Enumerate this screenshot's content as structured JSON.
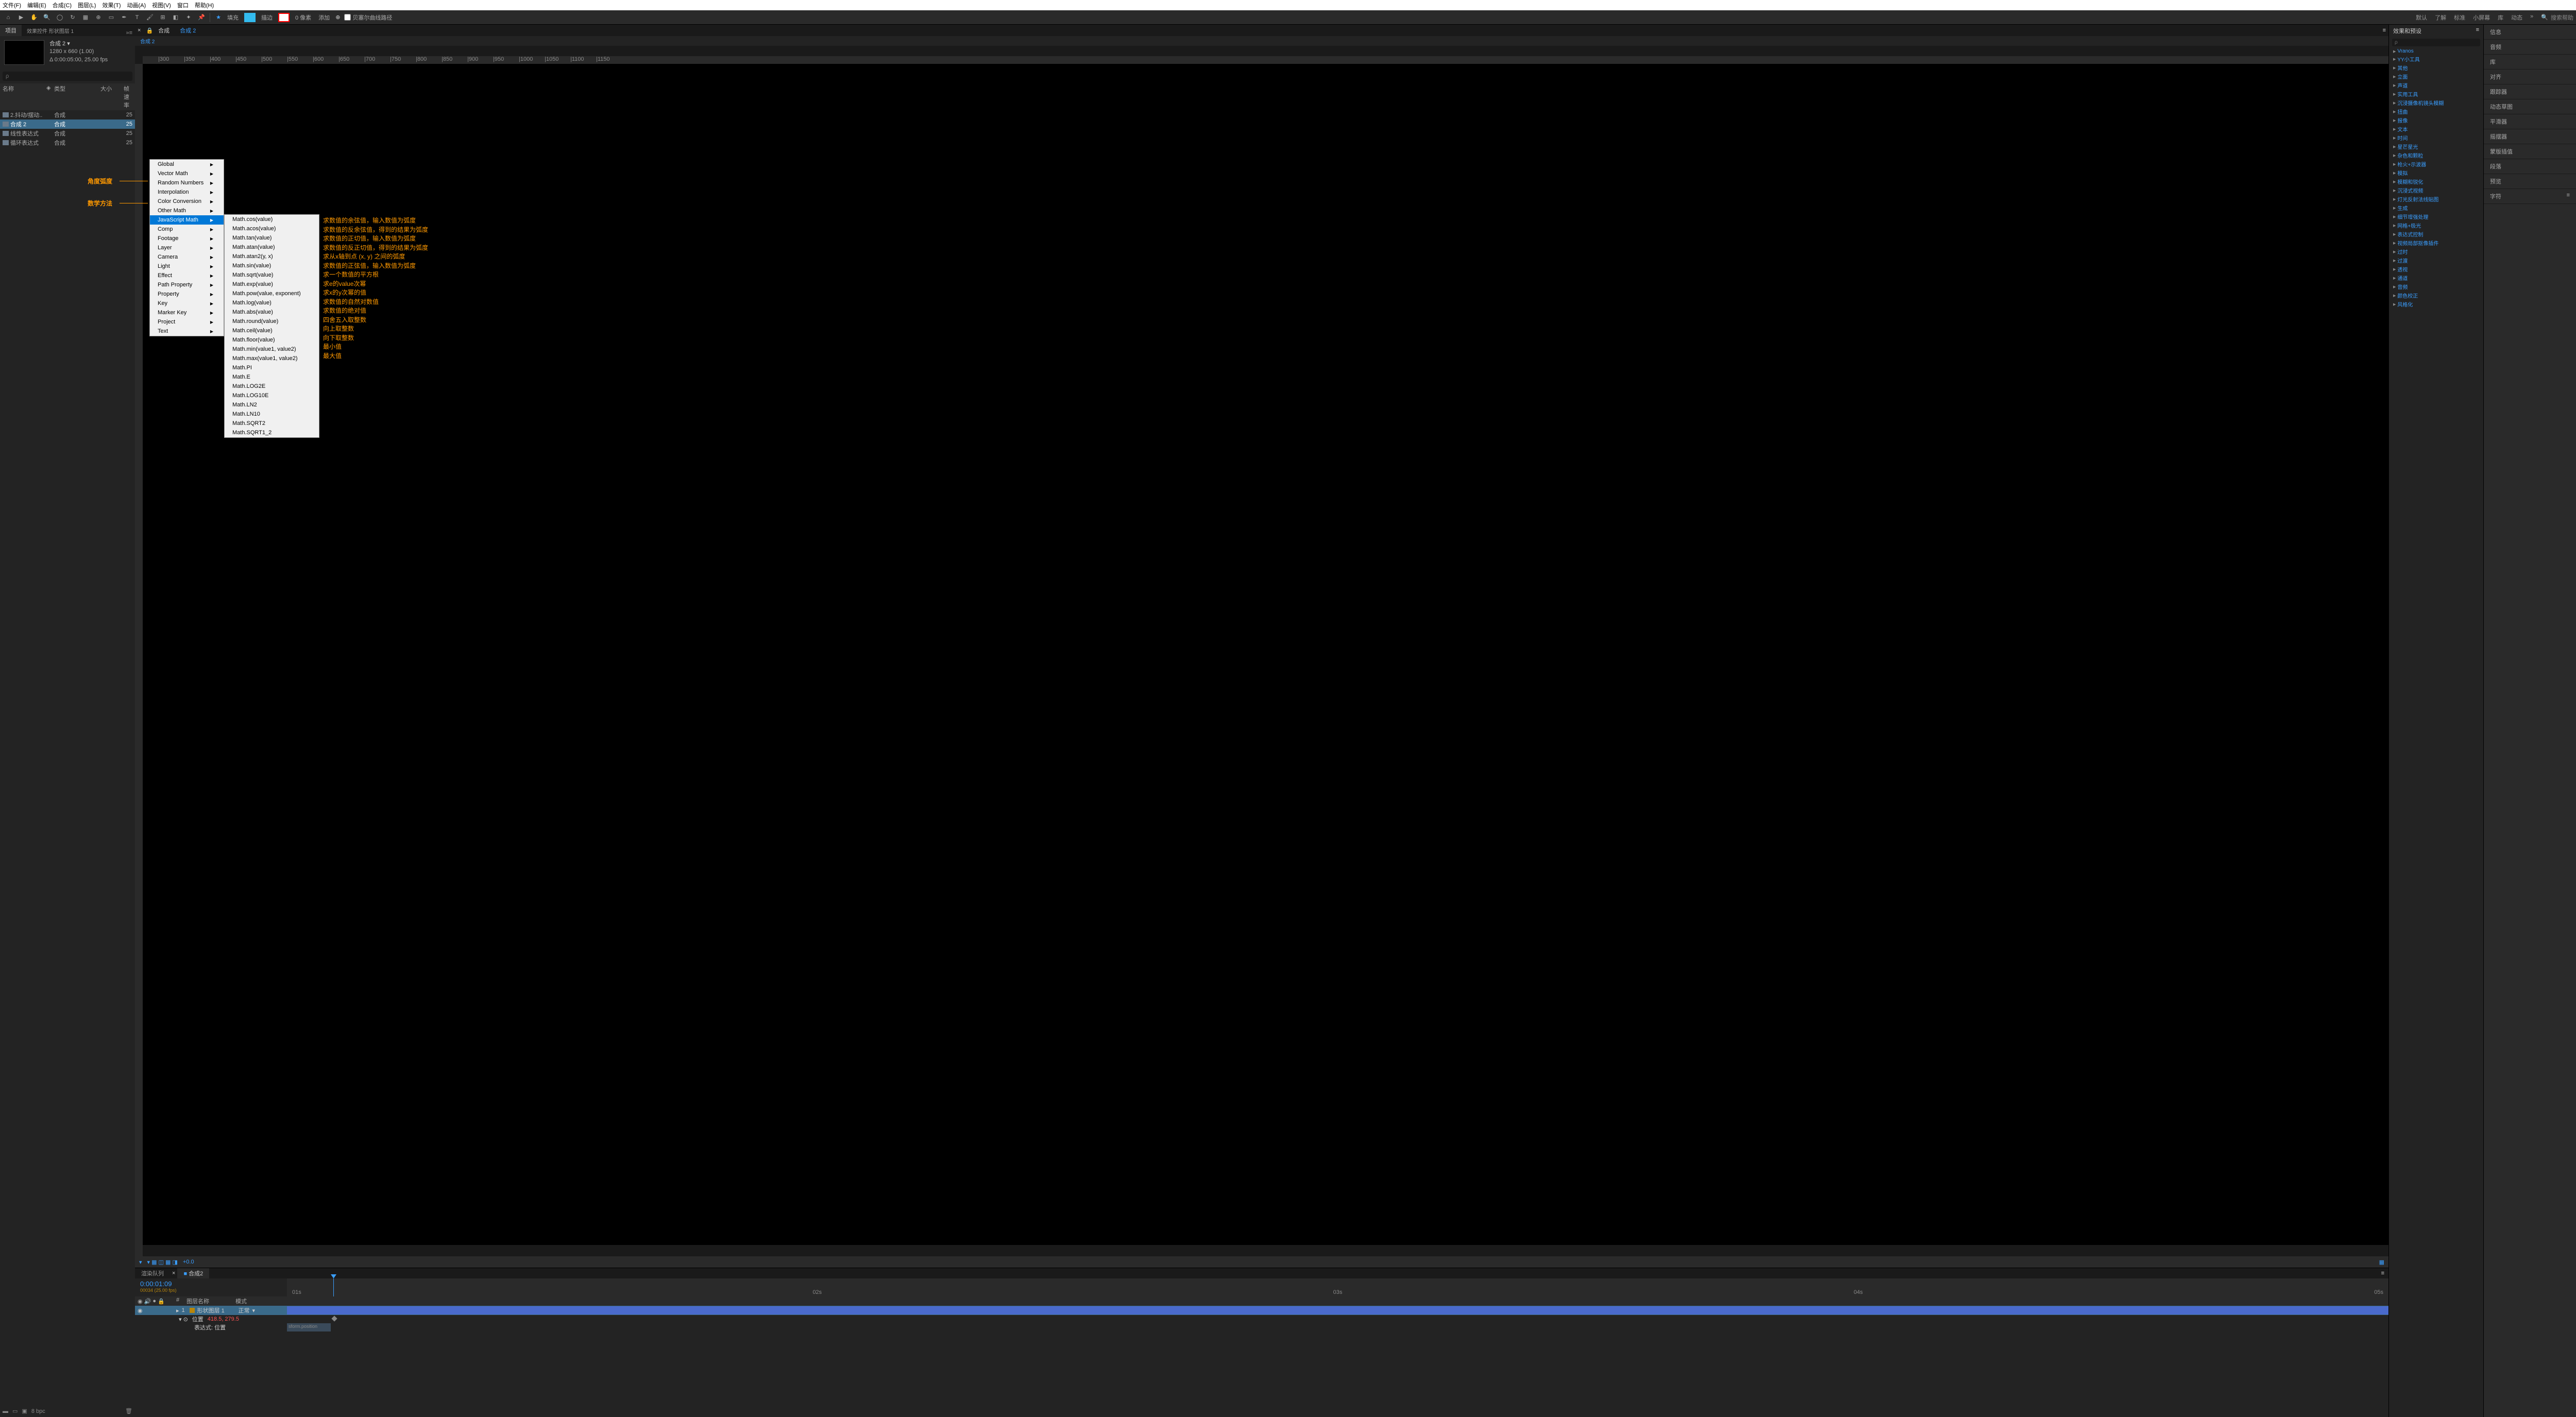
{
  "menubar": {
    "file": "文件(F)",
    "edit": "编辑(E)",
    "composition": "合成(C)",
    "layer": "图层(L)",
    "effect": "效果(T)",
    "animation": "动画(A)",
    "view": "视图(V)",
    "window": "窗口",
    "help": "帮助(H)"
  },
  "toolbar": {
    "fill_label": "填充",
    "fill_color": "#33bbee",
    "stroke_label": "描边",
    "stroke_px": "0 像素",
    "add_label": "添加",
    "bezier_label": "贝塞尔曲线路径"
  },
  "workspaces": {
    "default": "默认",
    "learn": "了解",
    "standard": "标准",
    "small_screen": "小屏幕",
    "library": "库",
    "animation": "动态",
    "search_placeholder": "搜索帮助"
  },
  "project": {
    "tab_label": "项目",
    "effect_controls_tab": "效果控件 形状图层 1",
    "comp_name": "合成 2",
    "comp_dims": "1280 x 660 (1.00)",
    "comp_dur": "Δ 0:00:05:00, 25.00 fps",
    "search_placeholder": "ρ",
    "cols": {
      "name": "名称",
      "tag": "",
      "type": "类型",
      "size": "大小",
      "fr": "帧速率"
    },
    "rows": [
      {
        "name": "2.抖动/摆动..",
        "type": "合成",
        "fr": "25",
        "sel": false
      },
      {
        "name": "合成 2",
        "type": "合成",
        "fr": "25",
        "sel": true
      },
      {
        "name": "线性表达式",
        "type": "合成",
        "fr": "25",
        "sel": false
      },
      {
        "name": "循环表达式",
        "type": "合成",
        "fr": "25",
        "sel": false
      }
    ],
    "footer_bpc": "8 bpc"
  },
  "viewer": {
    "tab1": "合成",
    "tab2": "合成 2",
    "breadcrumb": "合成 2",
    "footer_zoom": "+0.0"
  },
  "context_menu": {
    "items": [
      "Global",
      "Vector Math",
      "Random Numbers",
      "Interpolation",
      "Color Conversion",
      "Other Math",
      "JavaScript Math",
      "Comp",
      "Footage",
      "Layer",
      "Camera",
      "Light",
      "Effect",
      "Path Property",
      "Property",
      "Key",
      "Marker Key",
      "Project",
      "Text"
    ],
    "highlighted_index": 6
  },
  "submenu": {
    "items": [
      "Math.cos(value)",
      "Math.acos(value)",
      "Math.tan(value)",
      "Math.atan(value)",
      "Math.atan2(y, x)",
      "Math.sin(value)",
      "Math.sqrt(value)",
      "Math.exp(value)",
      "Math.pow(value, exponent)",
      "Math.log(value)",
      "Math.abs(value)",
      "Math.round(value)",
      "Math.ceil(value)",
      "Math.floor(value)",
      "Math.min(value1, value2)",
      "Math.max(value1, value2)",
      "Math.PI",
      "Math.E",
      "Math.LOG2E",
      "Math.LOG10E",
      "Math.LN2",
      "Math.LN10",
      "Math.SQRT2",
      "Math.SQRT1_2"
    ]
  },
  "annotations": {
    "angle_radian": "角度弧度",
    "math_method": "数学方法"
  },
  "descriptions": [
    "求数值的余弦值，输入数值为弧度",
    "求数值的反余弦值，得到的结果为弧度",
    "求数值的正切值，输入数值为弧度",
    "求数值的反正切值，得到的结果为弧度",
    "求从x轴到点 (x, y) 之间的弧度",
    "求数值的正弦值，输入数值为弧度",
    "求一个数值的平方根",
    "求e的value次幂",
    "求x的y次幂的值",
    "求数值的自然对数值",
    "求数值的绝对值",
    "四舍五入取整数",
    "向上取整数",
    "向下取整数",
    "最小值",
    "最大值"
  ],
  "timeline": {
    "tabs": {
      "render": "渲染队列",
      "comp": "合成2"
    },
    "timecode": "0:00:01:09",
    "subtime": "00034 (25.00 fps)",
    "cols": {
      "num": "#",
      "layer": "图层名称",
      "mode": "模式"
    },
    "marks": [
      "01s",
      "02s",
      "03s",
      "04s",
      "05s"
    ],
    "layer": {
      "num": "1",
      "name": "形状图层 1",
      "mode": "正常"
    },
    "prop_pos": "位置",
    "prop_val": "418.5, 279.5",
    "expr_label": "表达式: 位置",
    "expr_text": "sform.position"
  },
  "effects_panel": {
    "title": "效果和预设",
    "search": "ρ",
    "items": [
      "Vranos",
      "YY小工具",
      "其他",
      "立面",
      "声道",
      "实用工具",
      "沉浸摄像机镜头模糊",
      "扭曲",
      "报像",
      "文本",
      "时间",
      "星芒星光",
      "杂色和颗粒",
      "枪火+示波器",
      "模拟",
      "模糊和锐化",
      "沉浸式视频",
      "灯光反射法线贴图",
      "生成",
      "细节增强处理",
      "网格+极光",
      "表达式控制",
      "视频局部抠像插件",
      "过时",
      "过渡",
      "透视",
      "通道",
      "音频",
      "颜色校正",
      "风格化"
    ]
  },
  "side_panels": {
    "items": [
      "信息",
      "音频",
      "库",
      "对齐",
      "跟踪器",
      "动态草图",
      "平滑器",
      "摇摆器",
      "蒙版插值",
      "段落",
      "预览",
      "字符"
    ]
  }
}
